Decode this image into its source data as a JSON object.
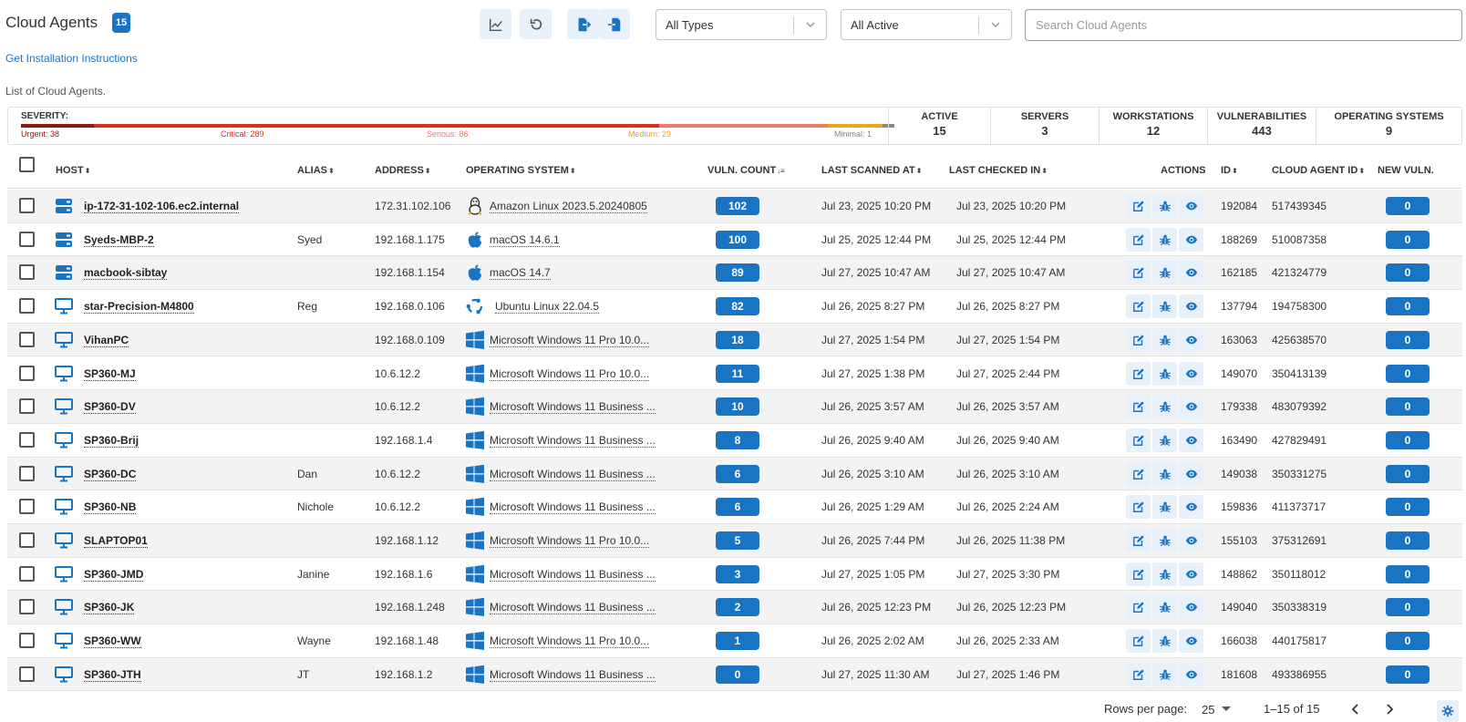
{
  "header": {
    "title": "Cloud Agents",
    "count": "15",
    "type_filter": "All Types",
    "status_filter": "All Active",
    "search_placeholder": "Search Cloud Agents"
  },
  "install_link": "Get Installation Instructions",
  "list_caption": "List of Cloud Agents.",
  "summary": {
    "severity_label": "SEVERITY:",
    "severity": [
      {
        "label": "Urgent: 38",
        "value": 38,
        "color": "#8b1a10"
      },
      {
        "label": "Critical: 289",
        "value": 289,
        "color": "#d9311f"
      },
      {
        "label": "Serious: 86",
        "value": 86,
        "color": "#ef7a66"
      },
      {
        "label": "Medium: 29",
        "value": 29,
        "color": "#f2a31c"
      },
      {
        "label": "Minimal: 1",
        "value": 1,
        "color": "#888888"
      }
    ],
    "stats": [
      {
        "label": "ACTIVE",
        "value": "15"
      },
      {
        "label": "SERVERS",
        "value": "3"
      },
      {
        "label": "WORKSTATIONS",
        "value": "12"
      },
      {
        "label": "VULNERABILITIES",
        "value": "443"
      },
      {
        "label": "OPERATING SYSTEMS",
        "value": "9"
      }
    ]
  },
  "columns": {
    "host": "HOST",
    "alias": "ALIAS",
    "address": "ADDRESS",
    "os": "OPERATING SYSTEM",
    "vuln": "VULN. COUNT",
    "scanned": "LAST SCANNED AT",
    "checked": "LAST CHECKED IN",
    "actions": "ACTIONS",
    "id": "ID",
    "agent_id": "CLOUD AGENT ID",
    "new_vuln": "NEW VULN."
  },
  "rows": [
    {
      "host": "ip-172-31-102-106.ec2.internal",
      "type": "server",
      "alias": "",
      "address": "172.31.102.106",
      "os": "Amazon Linux 2023.5.20240805",
      "os_icon": "linux-icon",
      "vuln": "102",
      "scanned": "Jul 23, 2025 10:20 PM",
      "checked": "Jul 23, 2025 10:20 PM",
      "id": "192084",
      "agent_id": "517439345",
      "new_vuln": "0"
    },
    {
      "host": "Syeds-MBP-2",
      "type": "server",
      "alias": "Syed",
      "address": "192.168.1.175",
      "os": "macOS 14.6.1",
      "os_icon": "apple-icon",
      "vuln": "100",
      "scanned": "Jul 25, 2025 12:44 PM",
      "checked": "Jul 25, 2025 12:44 PM",
      "id": "188269",
      "agent_id": "510087358",
      "new_vuln": "0"
    },
    {
      "host": "macbook-sibtay",
      "type": "server",
      "alias": "",
      "address": "192.168.1.154",
      "os": "macOS 14.7",
      "os_icon": "apple-icon",
      "vuln": "89",
      "scanned": "Jul 27, 2025 10:47 AM",
      "checked": "Jul 27, 2025 10:47 AM",
      "id": "162185",
      "agent_id": "421324779",
      "new_vuln": "0"
    },
    {
      "host": "star-Precision-M4800",
      "type": "workstation",
      "alias": "Reg",
      "address": "192.168.0.106",
      "os": "Ubuntu Linux 22.04.5",
      "os_icon": "ubuntu-icon",
      "vuln": "82",
      "scanned": "Jul 26, 2025 8:27 PM",
      "checked": "Jul 26, 2025 8:27 PM",
      "id": "137794",
      "agent_id": "194758300",
      "new_vuln": "0"
    },
    {
      "host": "VihanPC",
      "type": "workstation",
      "alias": "",
      "address": "192.168.0.109",
      "os": "Microsoft Windows 11 Pro 10.0...",
      "os_icon": "windows-icon",
      "vuln": "18",
      "scanned": "Jul 27, 2025 1:54 PM",
      "checked": "Jul 27, 2025 1:54 PM",
      "id": "163063",
      "agent_id": "425638570",
      "new_vuln": "0"
    },
    {
      "host": "SP360-MJ",
      "type": "workstation",
      "alias": "",
      "address": "10.6.12.2",
      "os": "Microsoft Windows 11 Pro 10.0...",
      "os_icon": "windows-icon",
      "vuln": "11",
      "scanned": "Jul 27, 2025 1:38 PM",
      "checked": "Jul 27, 2025 2:44 PM",
      "id": "149070",
      "agent_id": "350413139",
      "new_vuln": "0"
    },
    {
      "host": "SP360-DV",
      "type": "workstation",
      "alias": "",
      "address": "10.6.12.2",
      "os": "Microsoft Windows 11 Business ...",
      "os_icon": "windows-icon",
      "vuln": "10",
      "scanned": "Jul 26, 2025 3:57 AM",
      "checked": "Jul 26, 2025 3:57 AM",
      "id": "179338",
      "agent_id": "483079392",
      "new_vuln": "0"
    },
    {
      "host": "SP360-Brij",
      "type": "workstation",
      "alias": "",
      "address": "192.168.1.4",
      "os": "Microsoft Windows 11 Business ...",
      "os_icon": "windows-icon",
      "vuln": "8",
      "scanned": "Jul 26, 2025 9:40 AM",
      "checked": "Jul 26, 2025 9:40 AM",
      "id": "163490",
      "agent_id": "427829491",
      "new_vuln": "0"
    },
    {
      "host": "SP360-DC",
      "type": "workstation",
      "alias": "Dan",
      "address": "10.6.12.2",
      "os": "Microsoft Windows 11 Business ...",
      "os_icon": "windows-icon",
      "vuln": "6",
      "scanned": "Jul 26, 2025 3:10 AM",
      "checked": "Jul 26, 2025 3:10 AM",
      "id": "149038",
      "agent_id": "350331275",
      "new_vuln": "0"
    },
    {
      "host": "SP360-NB",
      "type": "workstation",
      "alias": "Nichole",
      "address": "10.6.12.2",
      "os": "Microsoft Windows 11 Business ...",
      "os_icon": "windows-icon",
      "vuln": "6",
      "scanned": "Jul 26, 2025 1:29 AM",
      "checked": "Jul 26, 2025 2:24 AM",
      "id": "159836",
      "agent_id": "411373717",
      "new_vuln": "0"
    },
    {
      "host": "SLAPTOP01",
      "type": "workstation",
      "alias": "",
      "address": "192.168.1.12",
      "os": "Microsoft Windows 11 Pro 10.0...",
      "os_icon": "windows-icon",
      "vuln": "5",
      "scanned": "Jul 26, 2025 7:44 PM",
      "checked": "Jul 26, 2025 11:38 PM",
      "id": "155103",
      "agent_id": "375312691",
      "new_vuln": "0"
    },
    {
      "host": "SP360-JMD",
      "type": "workstation",
      "alias": "Janine",
      "address": "192.168.1.6",
      "os": "Microsoft Windows 11 Business ...",
      "os_icon": "windows-icon",
      "vuln": "3",
      "scanned": "Jul 27, 2025 1:05 PM",
      "checked": "Jul 27, 2025 3:30 PM",
      "id": "148862",
      "agent_id": "350118012",
      "new_vuln": "0"
    },
    {
      "host": "SP360-JK",
      "type": "workstation",
      "alias": "",
      "address": "192.168.1.248",
      "os": "Microsoft Windows 11 Business ...",
      "os_icon": "windows-icon",
      "vuln": "2",
      "scanned": "Jul 26, 2025 12:23 PM",
      "checked": "Jul 26, 2025 12:23 PM",
      "id": "149040",
      "agent_id": "350338319",
      "new_vuln": "0"
    },
    {
      "host": "SP360-WW",
      "type": "workstation",
      "alias": "Wayne",
      "address": "192.168.1.48",
      "os": "Microsoft Windows 11 Pro 10.0...",
      "os_icon": "windows-icon",
      "vuln": "1",
      "scanned": "Jul 26, 2025 2:02 AM",
      "checked": "Jul 26, 2025 2:33 AM",
      "id": "166038",
      "agent_id": "440175817",
      "new_vuln": "0"
    },
    {
      "host": "SP360-JTH",
      "type": "workstation",
      "alias": "JT",
      "address": "192.168.1.2",
      "os": "Microsoft Windows 11 Business ...",
      "os_icon": "windows-icon",
      "vuln": "0",
      "scanned": "Jul 27, 2025 11:30 AM",
      "checked": "Jul 27, 2025 1:46 PM",
      "id": "181608",
      "agent_id": "493386955",
      "new_vuln": "0"
    }
  ],
  "footer": {
    "rows_per_page_label": "Rows per page:",
    "rows_per_page": "25",
    "range": "1–15 of 15"
  },
  "colors": {
    "accent": "#1a74c4",
    "accent_light": "#e8f1fa"
  }
}
